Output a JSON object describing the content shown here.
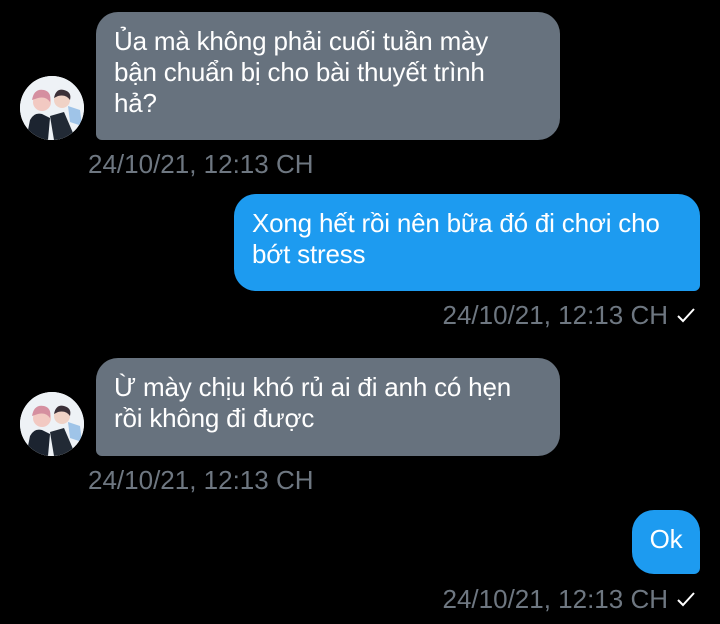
{
  "conversation": {
    "messages": [
      {
        "direction": "incoming",
        "text": "Ủa mà không phải cuối tuần mày\nbận chuẩn bị cho bài thuyết trình\nhả?",
        "timestamp": "24/10/21, 12:13 CH"
      },
      {
        "direction": "outgoing",
        "text": "Xong hết rồi nên bữa đó đi chơi cho\nbớt stress",
        "timestamp": "24/10/21, 12:13 CH"
      },
      {
        "direction": "incoming",
        "text": "Ừ mày chịu khó rủ ai đi anh có hẹn\nrồi không đi được",
        "timestamp": "24/10/21, 12:13 CH"
      },
      {
        "direction": "outgoing",
        "text": "Ok",
        "timestamp": "24/10/21, 12:13 CH"
      }
    ],
    "sent_status_icon": "checkmark-icon"
  },
  "colors": {
    "background": "#000000",
    "incoming_bubble": "#67727e",
    "outgoing_bubble": "#1d9bf0",
    "timestamp": "#6e7781"
  }
}
